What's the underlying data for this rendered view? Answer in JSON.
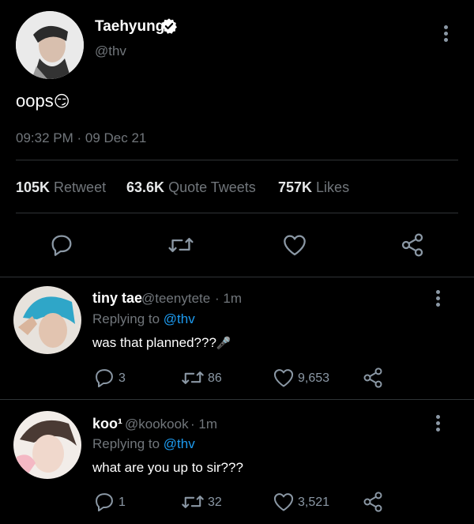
{
  "main_tweet": {
    "display_name": "Taehyung",
    "handle": "@thv",
    "text": "oops",
    "emoji": "😏",
    "timestamp": "09:32 PM · 09 Dec 21",
    "stats": [
      {
        "value": "105K",
        "label": "Retweet"
      },
      {
        "value": "63.6K",
        "label": "Quote Tweets"
      },
      {
        "value": "757K",
        "label": "Likes"
      }
    ],
    "actions": [
      "reply-icon",
      "retweet-icon",
      "like-icon",
      "share-icon"
    ]
  },
  "replies": [
    {
      "display_name": "tiny tae",
      "handle": "@teenytete",
      "time": "· 1m",
      "replying_label": "Replying to",
      "replying_to": "@thv",
      "text": "was that planned???",
      "emoji": "🎤",
      "reply_count": "3",
      "retweet_count": "86",
      "like_count": "9,653"
    },
    {
      "display_name": "koo¹",
      "handle": "@kookook",
      "time": "· 1m",
      "replying_label": "Replying to",
      "replying_to": "@thv",
      "text": "what are you up to sir???",
      "reply_count": "1",
      "retweet_count": "32",
      "like_count": "3,521"
    }
  ],
  "colors": {
    "background": "#000000",
    "text": "#e7e9ea",
    "muted": "#71767b",
    "link": "#1d9bf0",
    "divider": "#2f3336",
    "verified_badge": "#ffffff"
  }
}
